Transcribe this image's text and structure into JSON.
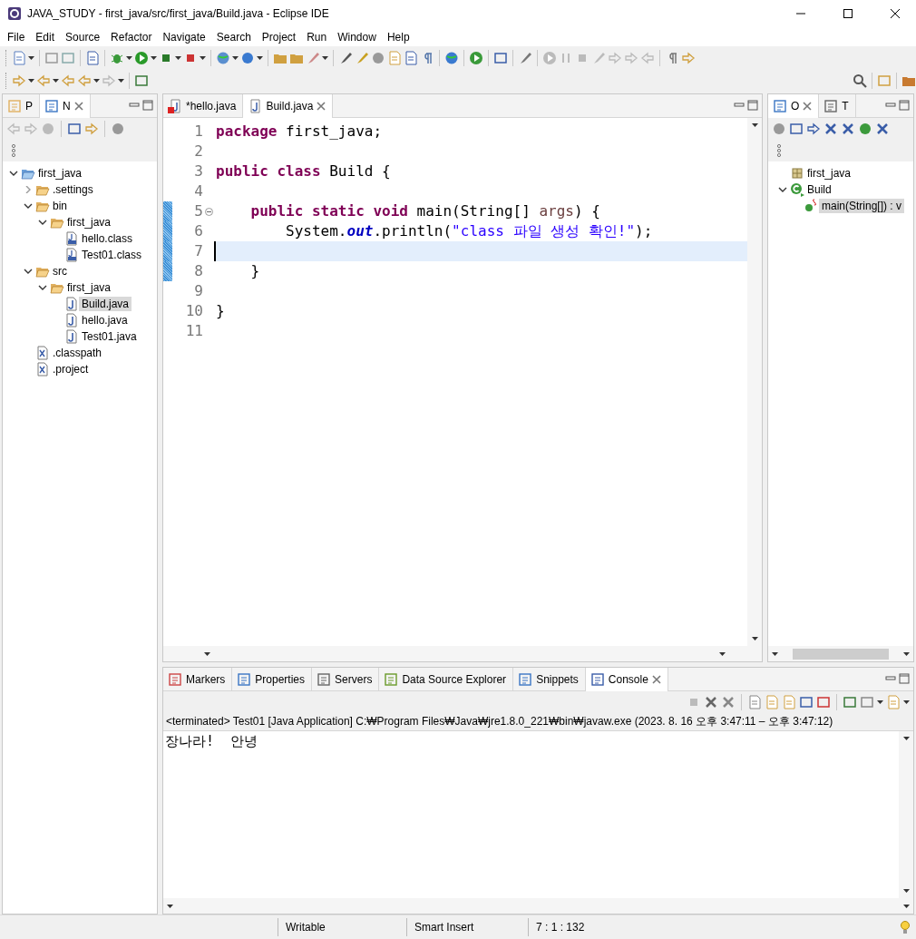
{
  "window": {
    "title": "JAVA_STUDY - first_java/src/first_java/Build.java - Eclipse IDE"
  },
  "menu": [
    "File",
    "Edit",
    "Source",
    "Refactor",
    "Navigate",
    "Search",
    "Project",
    "Run",
    "Window",
    "Help"
  ],
  "left_panel": {
    "tabs": [
      {
        "label": "P",
        "kind": "package",
        "selected": false
      },
      {
        "label": "N",
        "kind": "navigator",
        "selected": true
      }
    ],
    "tree": [
      {
        "label": "first_java",
        "kind": "project",
        "expanded": true,
        "selected": false,
        "children": [
          {
            "label": ".settings",
            "kind": "folder",
            "expanded": false,
            "selected": false
          },
          {
            "label": "bin",
            "kind": "folder",
            "expanded": true,
            "selected": false,
            "children": [
              {
                "label": "first_java",
                "kind": "folder",
                "expanded": true,
                "selected": false,
                "children": [
                  {
                    "label": "hello.class",
                    "kind": "class-file",
                    "selected": false
                  },
                  {
                    "label": "Test01.class",
                    "kind": "class-file",
                    "selected": false
                  }
                ]
              }
            ]
          },
          {
            "label": "src",
            "kind": "folder",
            "expanded": true,
            "selected": false,
            "children": [
              {
                "label": "first_java",
                "kind": "folder",
                "expanded": true,
                "selected": false,
                "children": [
                  {
                    "label": "Build.java",
                    "kind": "java-file",
                    "selected": true
                  },
                  {
                    "label": "hello.java",
                    "kind": "java-file",
                    "selected": false
                  },
                  {
                    "label": "Test01.java",
                    "kind": "java-file",
                    "selected": false
                  }
                ]
              }
            ]
          },
          {
            "label": ".classpath",
            "kind": "xml-file",
            "selected": false
          },
          {
            "label": ".project",
            "kind": "xml-file",
            "selected": false
          }
        ]
      }
    ]
  },
  "editor": {
    "tabs": [
      {
        "label": "*hello.java",
        "kind": "error",
        "selected": false
      },
      {
        "label": "Build.java",
        "kind": "java",
        "selected": true
      }
    ],
    "lines": [
      {
        "number": "1",
        "current": false,
        "changed": false,
        "tokens": [
          {
            "kind": "keyword",
            "text": "package"
          },
          {
            "kind": "plain",
            "text": " first_java;"
          }
        ]
      },
      {
        "number": "2",
        "current": false,
        "changed": false
      },
      {
        "number": "3",
        "current": false,
        "changed": false,
        "tokens": [
          {
            "kind": "keyword",
            "text": "public class"
          },
          {
            "kind": "plain",
            "text": " Build {"
          }
        ]
      },
      {
        "number": "4",
        "current": false,
        "changed": false
      },
      {
        "number": "5",
        "current": false,
        "changed": true,
        "foldable": true,
        "tokens": [
          {
            "kind": "keyword",
            "text": "    public static void"
          },
          {
            "kind": "plain",
            "text": " main(String[] "
          },
          {
            "kind": "param",
            "text": "args"
          },
          {
            "kind": "plain",
            "text": ") {"
          }
        ]
      },
      {
        "number": "6",
        "current": false,
        "changed": true,
        "tokens": [
          {
            "kind": "plain",
            "text": "        System."
          },
          {
            "kind": "field",
            "text": "out"
          },
          {
            "kind": "plain",
            "text": ".println("
          },
          {
            "kind": "string",
            "text": "\"class 파일 생성 확인!\""
          },
          {
            "kind": "plain",
            "text": ");"
          }
        ]
      },
      {
        "number": "7",
        "current": true,
        "changed": true
      },
      {
        "number": "8",
        "current": false,
        "changed": true,
        "tokens": [
          {
            "kind": "plain",
            "text": "    }"
          }
        ]
      },
      {
        "number": "9",
        "current": false,
        "changed": false
      },
      {
        "number": "10",
        "current": false,
        "changed": false,
        "tokens": [
          {
            "kind": "plain",
            "text": "}"
          }
        ]
      },
      {
        "number": "11",
        "current": false,
        "changed": false
      }
    ]
  },
  "right_panel": {
    "tabs": [
      {
        "label": "O",
        "kind": "outline",
        "selected": true
      },
      {
        "label": "T",
        "kind": "task",
        "selected": false
      }
    ],
    "tree": [
      {
        "label": "first_java",
        "kind": "package",
        "selected": false
      },
      {
        "label": "Build",
        "kind": "class",
        "expanded": true,
        "selected": false,
        "children": [
          {
            "label": "main(String[]) : v",
            "kind": "method",
            "selected": true
          }
        ]
      }
    ]
  },
  "console_panel": {
    "tabs": [
      {
        "label": "Markers",
        "kind": "markers",
        "selected": false
      },
      {
        "label": "Properties",
        "kind": "properties",
        "selected": false
      },
      {
        "label": "Servers",
        "kind": "servers",
        "selected": false
      },
      {
        "label": "Data Source Explorer",
        "kind": "datasource",
        "selected": false
      },
      {
        "label": "Snippets",
        "kind": "snippets",
        "selected": false
      },
      {
        "label": "Console",
        "kind": "console",
        "selected": true
      }
    ],
    "header": "<terminated> Test01 [Java Application] C:₩Program Files₩Java₩jre1.8.0_221₩bin₩javaw.exe  (2023. 8. 16 오후 3:47:11 – 오후 3:47:12)",
    "output": [
      "장나라!  안녕"
    ]
  },
  "status_bar": [
    "Writable",
    "Smart Insert",
    "7 : 1 : 132"
  ]
}
